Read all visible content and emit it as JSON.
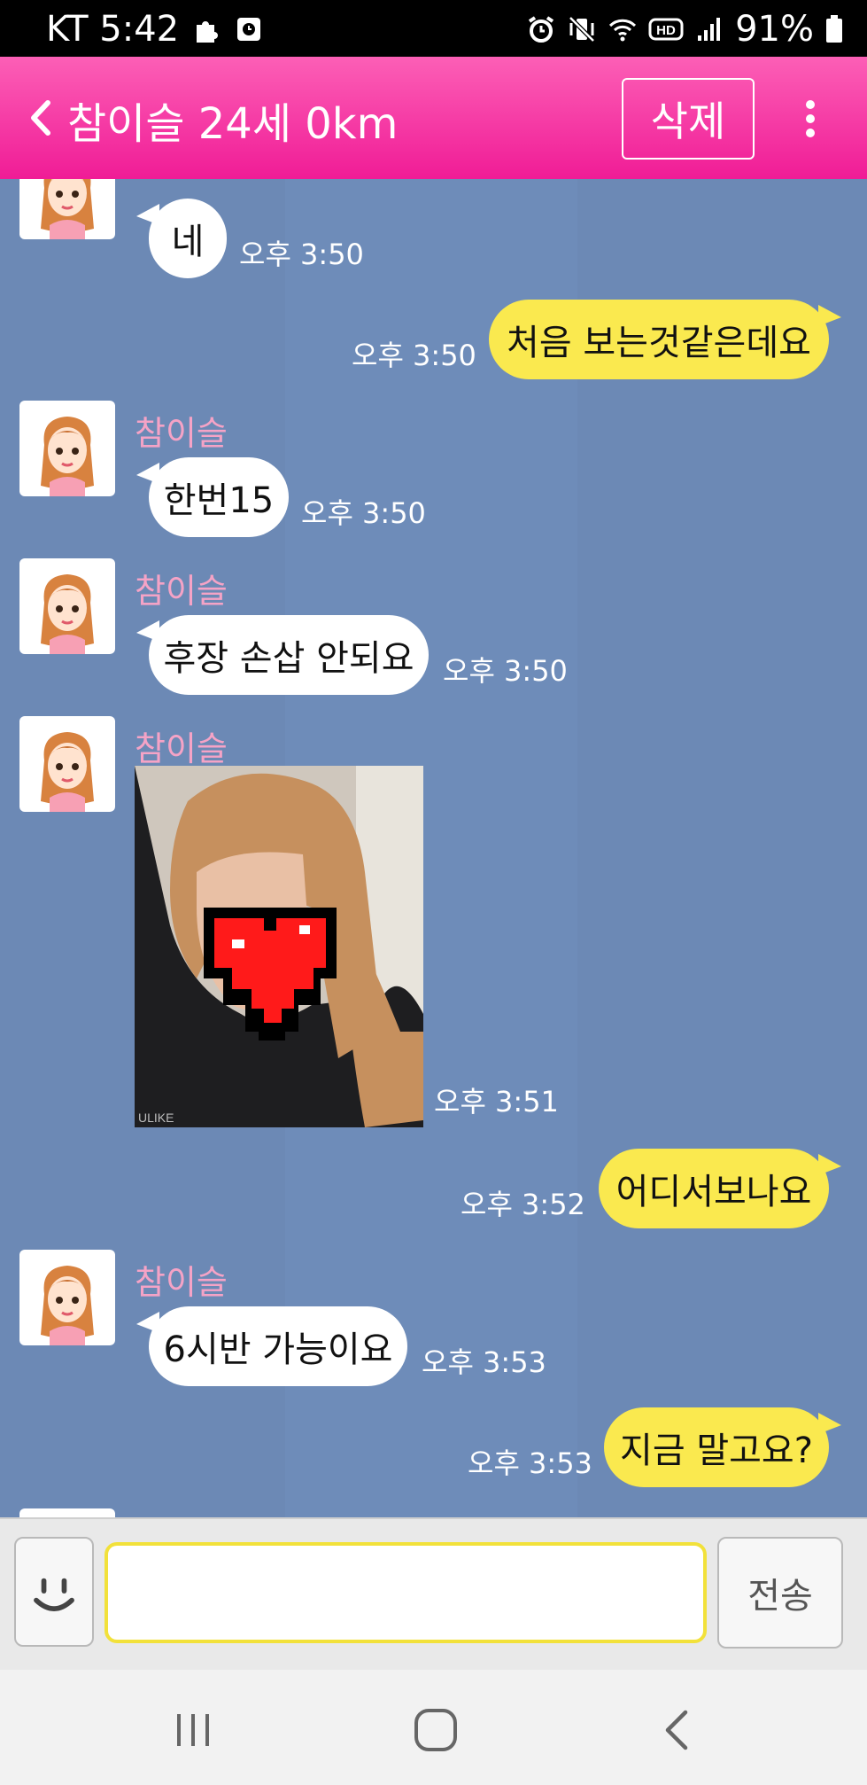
{
  "status_bar": {
    "carrier_time": "KT 5:42",
    "battery": "91%"
  },
  "header": {
    "title": "참이슬 24세 0km",
    "delete_label": "삭제"
  },
  "messages": {
    "m0": {
      "text": "네",
      "time": "오후 3:50"
    },
    "m1": {
      "text": "처음 보는것같은데요",
      "time": "오후 3:50"
    },
    "m2": {
      "sender": "참이슬",
      "text": "한번15",
      "time": "오후 3:50"
    },
    "m3": {
      "sender": "참이슬",
      "text": "후장 손삽 안되요",
      "time": "오후 3:50"
    },
    "m4": {
      "sender": "참이슬",
      "photo_watermark": "ULIKE",
      "time": "오후 3:51"
    },
    "m5": {
      "text": "어디서보나요",
      "time": "오후 3:52"
    },
    "m6": {
      "sender": "참이슬",
      "text": "6시반 가능이요",
      "time": "오후 3:53"
    },
    "m7": {
      "text": "지금 말고요?",
      "time": "오후 3:53"
    }
  },
  "input_bar": {
    "input_value": "",
    "send_label": "전송"
  },
  "colors": {
    "header_pink": "#f01c96",
    "chat_bg": "#6c89b5",
    "incoming_bubble": "#ffffff",
    "outgoing_bubble": "#fae94f",
    "sender_name": "#f5a3c6"
  },
  "icons": {
    "back": "chevron-left-icon",
    "more": "more-vertical-icon",
    "emoji": "smiley-icon",
    "nav_recents": "recents-icon",
    "nav_home": "home-icon",
    "nav_back": "back-icon"
  }
}
